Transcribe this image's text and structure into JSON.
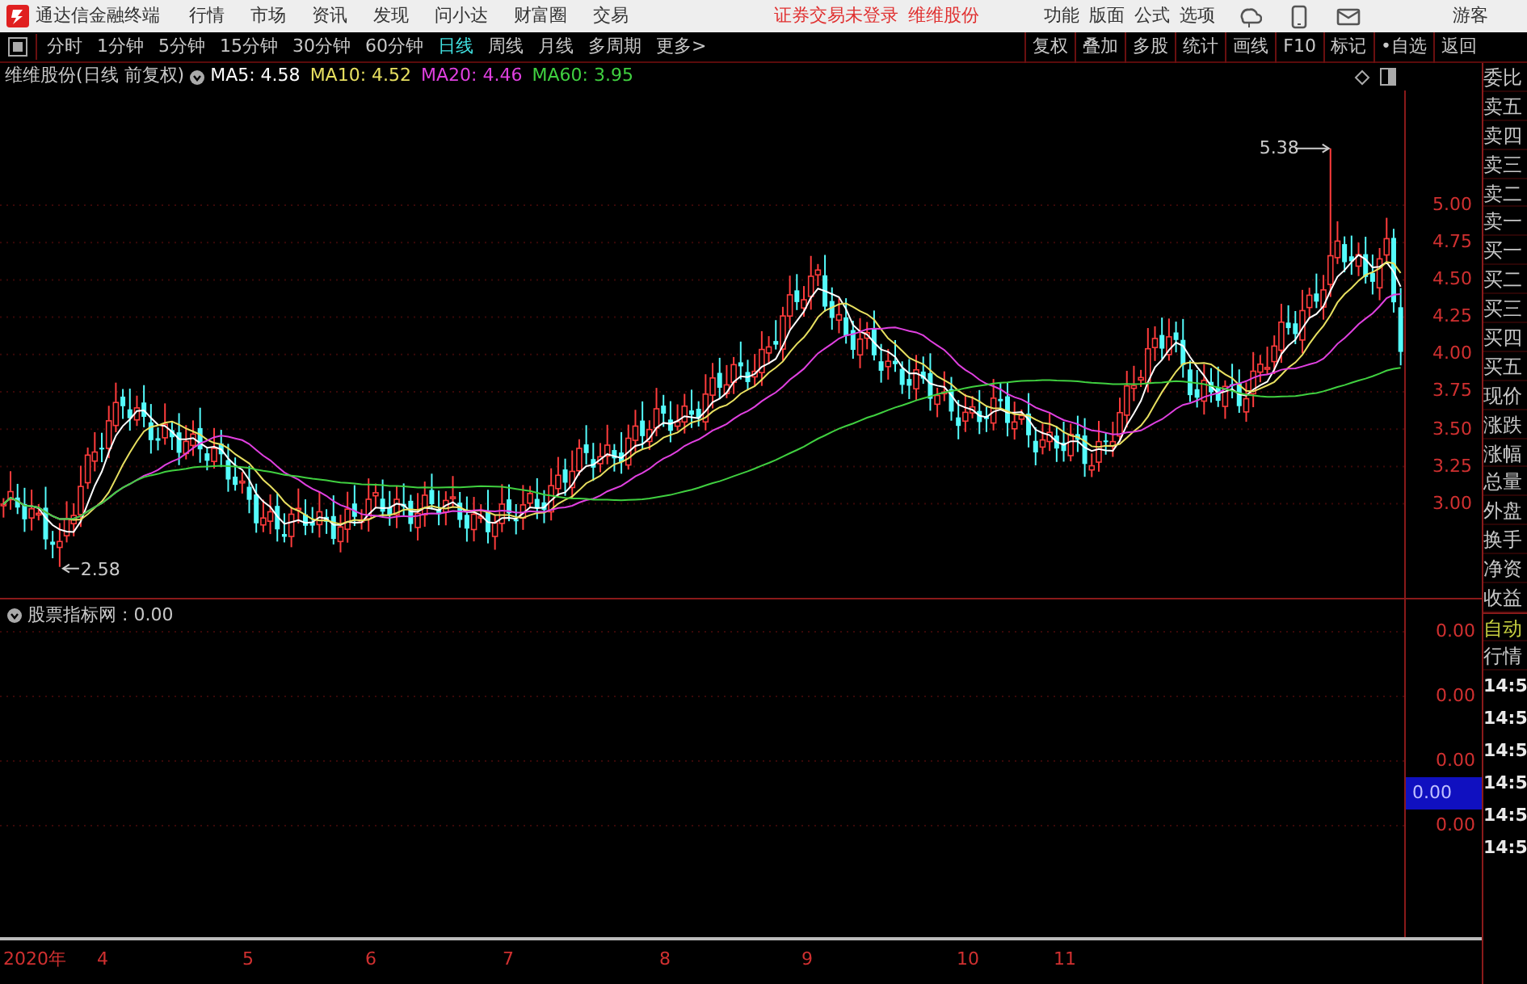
{
  "title_bar": {
    "app_name": "通达信金融终端",
    "menus": [
      "行情",
      "市场",
      "资讯",
      "发现",
      "问小达",
      "财富圈",
      "交易"
    ],
    "notices": [
      "证券交易未登录",
      "维维股份"
    ],
    "tools": [
      "功能",
      "版面",
      "公式",
      "选项"
    ],
    "user": "游客"
  },
  "toolbar": {
    "periods": [
      {
        "label": "分时",
        "selected": false
      },
      {
        "label": "1分钟",
        "selected": false
      },
      {
        "label": "5分钟",
        "selected": false
      },
      {
        "label": "15分钟",
        "selected": false
      },
      {
        "label": "30分钟",
        "selected": false
      },
      {
        "label": "60分钟",
        "selected": false
      },
      {
        "label": "日线",
        "selected": true
      },
      {
        "label": "周线",
        "selected": false
      },
      {
        "label": "月线",
        "selected": false
      },
      {
        "label": "多周期",
        "selected": false
      }
    ],
    "more": "更多>",
    "actions": [
      "复权",
      "叠加",
      "多股",
      "统计",
      "画线",
      "F10",
      "标记",
      "•自选",
      "返回"
    ]
  },
  "price_pane": {
    "stock": "维维股份(日线 前复权)",
    "indicators": [
      {
        "name": "MA5:",
        "value": "4.58",
        "color": "#ffffff"
      },
      {
        "name": "MA10:",
        "value": "4.52",
        "color": "#e8e060"
      },
      {
        "name": "MA20:",
        "value": "4.46",
        "color": "#e040e0"
      },
      {
        "name": "MA60:",
        "value": "3.95",
        "color": "#40d040"
      }
    ],
    "axis_labels": [
      "5.00",
      "4.75",
      "4.50",
      "4.25",
      "4.00",
      "3.75",
      "3.50",
      "3.25",
      "3.00"
    ],
    "high_mark": "5.38",
    "low_mark": "2.58"
  },
  "indicator_pane": {
    "title": "股票指标网 : 0.00",
    "axis_labels": [
      {
        "text": "0.00",
        "highlighted": false
      },
      {
        "text": "0.00",
        "highlighted": false
      },
      {
        "text": "0.00",
        "highlighted": false
      },
      {
        "text": "0.00",
        "highlighted": true
      },
      {
        "text": "0.00",
        "highlighted": false
      }
    ]
  },
  "date_axis": [
    "2020年",
    "4",
    "5",
    "6",
    "7",
    "8",
    "9",
    "10",
    "11"
  ],
  "side_panel": {
    "fields": [
      "委比",
      "卖五",
      "卖四",
      "卖三",
      "卖二",
      "卖一",
      "买一",
      "买二",
      "买三",
      "买四",
      "买五",
      "现价",
      "涨跌",
      "涨幅",
      "总量",
      "外盘",
      "换手",
      "净资",
      "收益"
    ],
    "mode_label": "自动",
    "quote_label": "行情",
    "times": [
      "14:5",
      "14:5",
      "14:5",
      "14:5",
      "14:5",
      "14:5"
    ]
  }
}
